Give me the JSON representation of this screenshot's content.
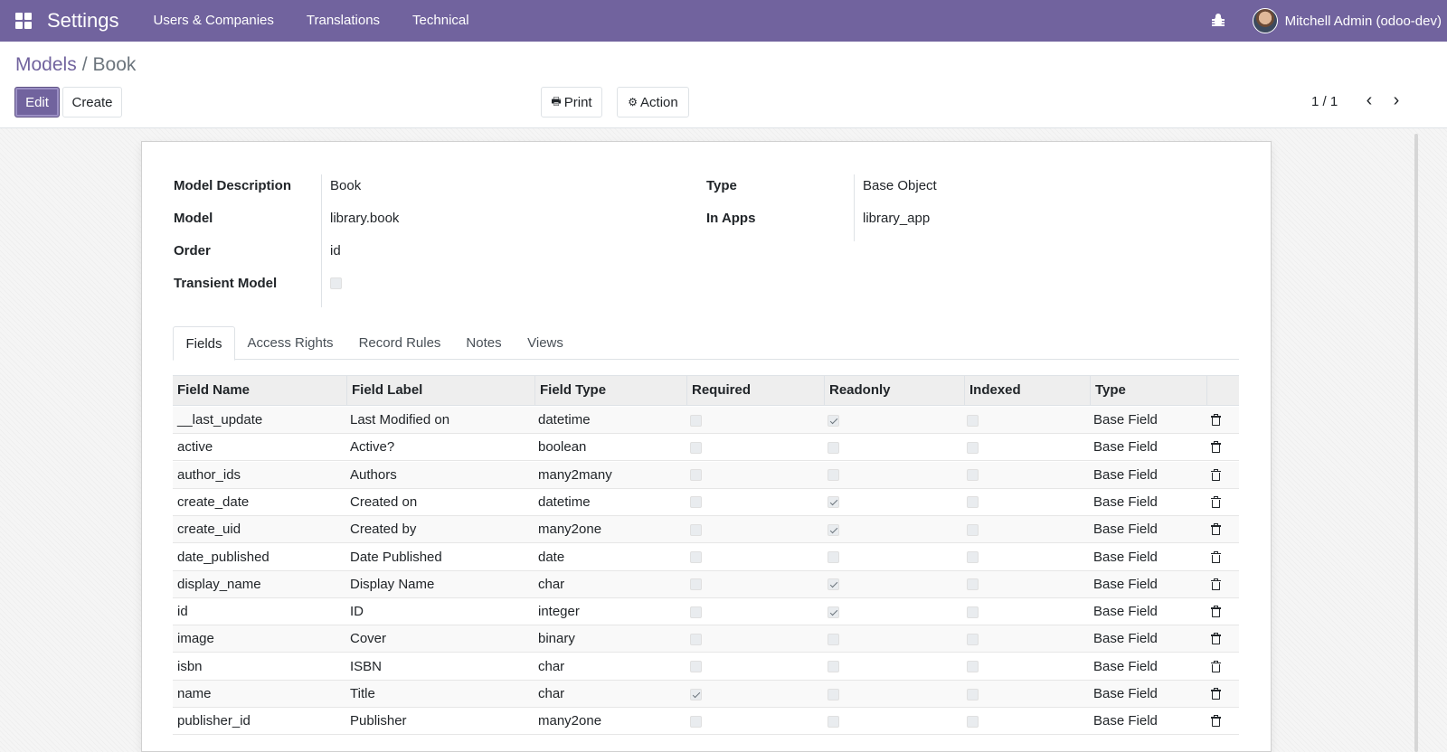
{
  "navbar": {
    "brand": "Settings",
    "menu": [
      "Users & Companies",
      "Translations",
      "Technical"
    ],
    "user": "Mitchell Admin (odoo-dev)"
  },
  "breadcrumb": {
    "parent": "Models",
    "separator": "/",
    "current": "Book"
  },
  "toolbar": {
    "edit": "Edit",
    "create": "Create",
    "print": "Print",
    "action": "Action",
    "pager": "1 / 1"
  },
  "form": {
    "model_description_label": "Model Description",
    "model_description": "Book",
    "model_label": "Model",
    "model": "library.book",
    "order_label": "Order",
    "order": "id",
    "transient_label": "Transient Model",
    "transient": false,
    "type_label": "Type",
    "type": "Base Object",
    "in_apps_label": "In Apps",
    "in_apps": "library_app"
  },
  "tabs": [
    "Fields",
    "Access Rights",
    "Record Rules",
    "Notes",
    "Views"
  ],
  "table": {
    "columns": [
      "Field Name",
      "Field Label",
      "Field Type",
      "Required",
      "Readonly",
      "Indexed",
      "Type"
    ],
    "rows": [
      {
        "name": "__last_update",
        "label": "Last Modified on",
        "ftype": "datetime",
        "required": false,
        "readonly": true,
        "indexed": false,
        "type": "Base Field"
      },
      {
        "name": "active",
        "label": "Active?",
        "ftype": "boolean",
        "required": false,
        "readonly": false,
        "indexed": false,
        "type": "Base Field"
      },
      {
        "name": "author_ids",
        "label": "Authors",
        "ftype": "many2many",
        "required": false,
        "readonly": false,
        "indexed": false,
        "type": "Base Field"
      },
      {
        "name": "create_date",
        "label": "Created on",
        "ftype": "datetime",
        "required": false,
        "readonly": true,
        "indexed": false,
        "type": "Base Field"
      },
      {
        "name": "create_uid",
        "label": "Created by",
        "ftype": "many2one",
        "required": false,
        "readonly": true,
        "indexed": false,
        "type": "Base Field"
      },
      {
        "name": "date_published",
        "label": "Date Published",
        "ftype": "date",
        "required": false,
        "readonly": false,
        "indexed": false,
        "type": "Base Field"
      },
      {
        "name": "display_name",
        "label": "Display Name",
        "ftype": "char",
        "required": false,
        "readonly": true,
        "indexed": false,
        "type": "Base Field"
      },
      {
        "name": "id",
        "label": "ID",
        "ftype": "integer",
        "required": false,
        "readonly": true,
        "indexed": false,
        "type": "Base Field"
      },
      {
        "name": "image",
        "label": "Cover",
        "ftype": "binary",
        "required": false,
        "readonly": false,
        "indexed": false,
        "type": "Base Field"
      },
      {
        "name": "isbn",
        "label": "ISBN",
        "ftype": "char",
        "required": false,
        "readonly": false,
        "indexed": false,
        "type": "Base Field"
      },
      {
        "name": "name",
        "label": "Title",
        "ftype": "char",
        "required": true,
        "readonly": false,
        "indexed": false,
        "type": "Base Field"
      },
      {
        "name": "publisher_id",
        "label": "Publisher",
        "ftype": "many2one",
        "required": false,
        "readonly": false,
        "indexed": false,
        "type": "Base Field"
      }
    ]
  },
  "colors": {
    "brand": "#71639e"
  }
}
